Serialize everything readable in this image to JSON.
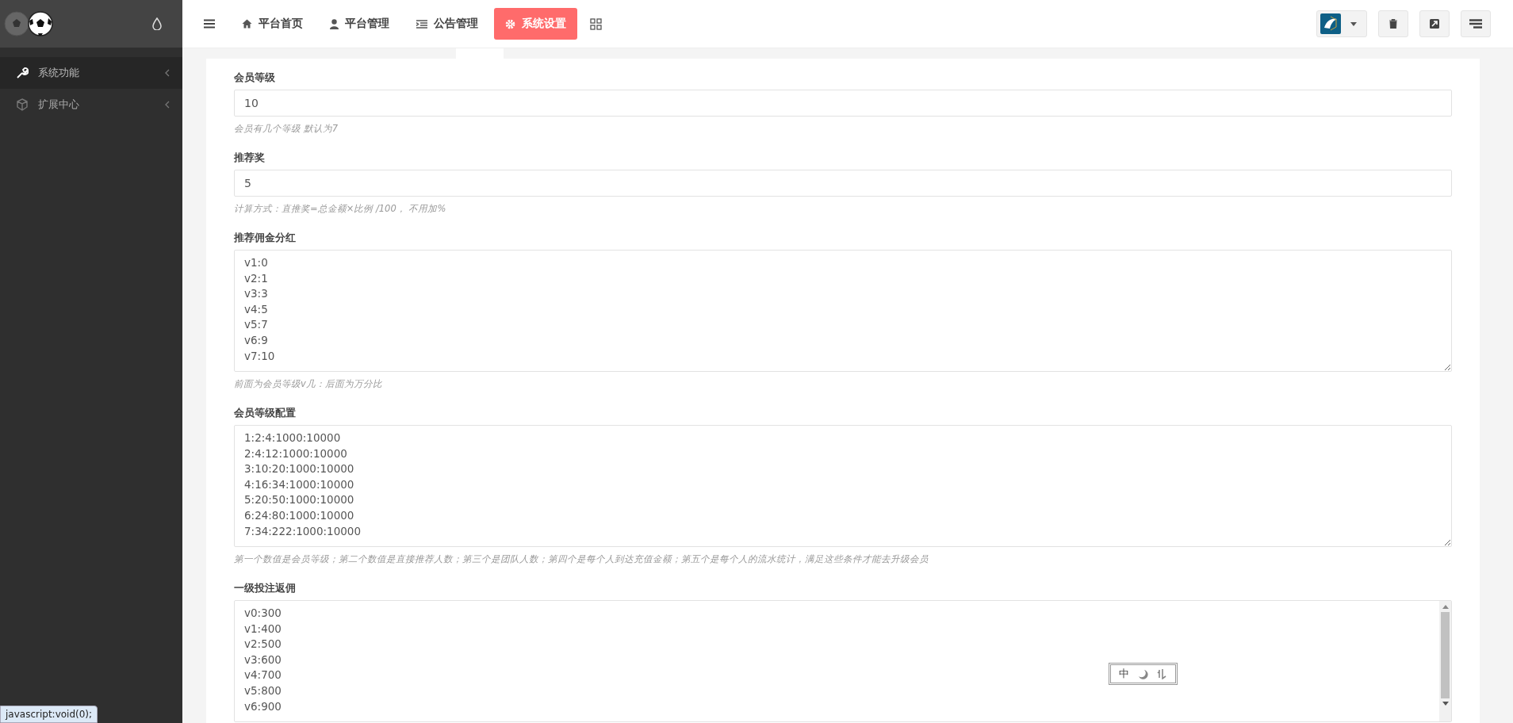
{
  "sidebar": {
    "items": [
      {
        "label": "系统功能",
        "selected": true
      },
      {
        "label": "扩展中心",
        "selected": false
      }
    ]
  },
  "topnav": {
    "tabs": [
      {
        "label": "平台首页",
        "selected": false
      },
      {
        "label": "平台管理",
        "selected": false
      },
      {
        "label": "公告管理",
        "selected": false
      },
      {
        "label": "系统设置",
        "selected": true
      }
    ]
  },
  "form": {
    "fields": [
      {
        "kind": "input",
        "label": "会员等级",
        "value": "10",
        "hint": "会员有几个等级 默认为7"
      },
      {
        "kind": "input",
        "label": "推荐奖",
        "value": "5",
        "hint": "计算方式：直推奖=总金额×比例 /100， 不用加%"
      },
      {
        "kind": "textarea",
        "label": "推荐佣金分红",
        "lines": [
          "v1:0",
          "v2:1",
          "v3:3",
          "v4:5",
          "v5:7",
          "v6:9",
          "v7:10"
        ],
        "hint": "前面为会员等级v几：后面为万分比"
      },
      {
        "kind": "textarea",
        "label": "会员等级配置",
        "lines": [
          "1:2:4:1000:10000",
          "2:4:12:1000:10000",
          "3:10:20:1000:10000",
          "4:16:34:1000:10000",
          "5:20:50:1000:10000",
          "6:24:80:1000:10000",
          "7:34:222:1000:10000"
        ],
        "hint": "第一个数值是会员等级；第二个数值是直接推荐人数；第三个是团队人数；第四个是每个人到达充值金额；第五个是每个人的流水统计，满足这些条件才能去升级会员"
      },
      {
        "kind": "scrolling_textarea",
        "label": "一级投注返佣",
        "lines": [
          "v0:300",
          "v1:400",
          "v2:500",
          "v3:600",
          "v4:700",
          "v5:800",
          "v6:900"
        ]
      }
    ]
  },
  "ime_toolbar": {
    "mode": "中"
  },
  "status_bar": {
    "url": "javascript:void(0);"
  }
}
